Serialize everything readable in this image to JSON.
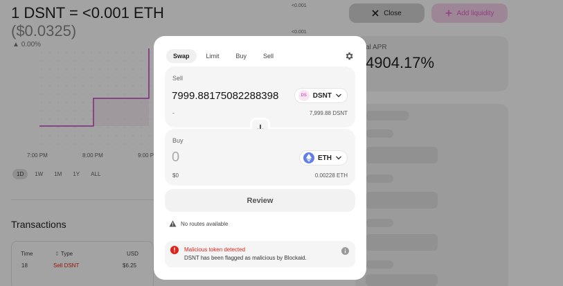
{
  "header": {
    "price_title": "1 DSNT = <0.001 ETH",
    "price_usd": "($0.0325)",
    "price_change": "0.00%",
    "axis_right_top": "<0.001",
    "axis_right_second": "<0.001"
  },
  "chart": {
    "time_labels": [
      "7:00 PM",
      "8:00 PM",
      "9:00 PM"
    ],
    "ranges": [
      "1D",
      "1W",
      "1M",
      "1Y",
      "ALL"
    ],
    "active_range": "1D",
    "line_color": "#c43fbd"
  },
  "actions": {
    "close_label": "Close",
    "add_liquidity_label": "Add liquidity"
  },
  "stats": {
    "apr_label": "al APR",
    "apr_value": "4904.17%"
  },
  "transactions": {
    "title": "Transactions",
    "columns": [
      "Time",
      "Type",
      "USD"
    ],
    "row": {
      "time": "18",
      "type": "Sell DSNT",
      "usd": "$6.25"
    }
  },
  "swap": {
    "tabs": [
      "Swap",
      "Limit",
      "Buy",
      "Sell"
    ],
    "active_tab": "Swap",
    "sell": {
      "label": "Sell",
      "amount": "7999.88175082288398",
      "token": "DSNT",
      "token_icon_text": "DS",
      "usd": "-",
      "balance": "7,999.88 DSNT"
    },
    "buy": {
      "label": "Buy",
      "amount_placeholder": "0",
      "token": "ETH",
      "usd": "$0",
      "balance": "0.00228 ETH"
    },
    "review_label": "Review",
    "no_routes": "No routes available",
    "alert": {
      "title": "Malicious token detected",
      "body": "DSNT has been flagged as malicious by Blockaid."
    }
  },
  "colors": {
    "accent_pink": "#e55ec9",
    "danger_red": "#e0231b",
    "eth_blue": "#627eea"
  }
}
